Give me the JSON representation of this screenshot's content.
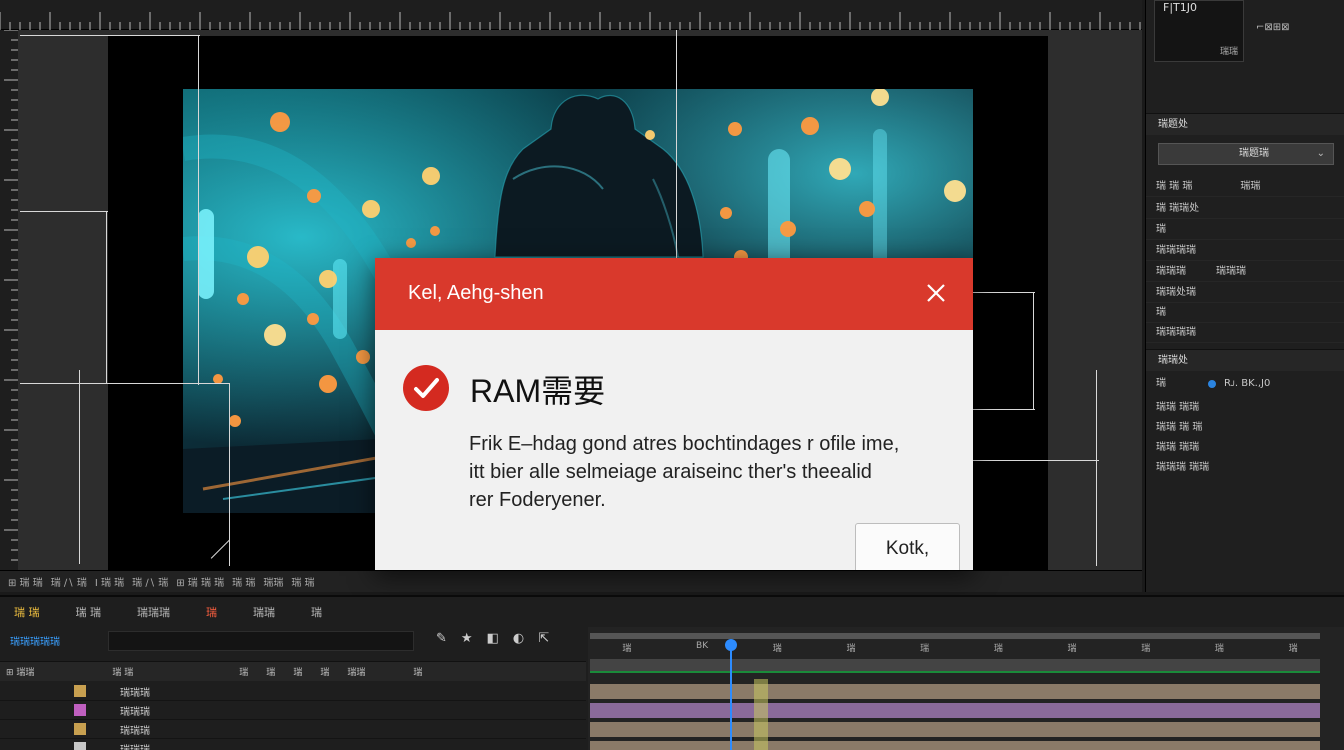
{
  "top_right": {
    "label": "F|T1J0",
    "sub": "⌐⊠⊞⊠"
  },
  "dialog": {
    "title": "Kel, Aehg-shen",
    "heading": "RAM需要",
    "body_lines": [
      "Frik E–hdag gond atres bochtindages r ofile ime,",
      "itt bier alle selmeiage araiseinc ther's theealid",
      "rer Foderyener."
    ],
    "ok_label": "Kotk,",
    "colors": {
      "titlebar": "#d9392c",
      "icon": "#d42a20",
      "background": "#f1f1f1"
    }
  },
  "right_panel": {
    "section1": "瑞题处",
    "dropdown": "瑞题瑞",
    "rows": [
      "瑞 瑞 瑞",
      "瑞 瑞瑞处",
      "瑞",
      "瑞瑞瑞瑞",
      "瑞瑞瑞",
      "瑞瑞处瑞",
      "瑞",
      "瑞瑞瑞瑞"
    ],
    "row2_right": "瑞瑞",
    "row5_right": "瑞瑞瑞",
    "section2": "瑞题处",
    "section3": "瑞瑞处",
    "props": [
      "瑞",
      "瑞瑞 瑞瑞",
      "瑞瑞 瑞 瑞",
      "瑞瑞 瑞瑞",
      "瑞瑞瑞 瑞瑞"
    ],
    "prop_value": "Rᴊ. BK.,J0"
  },
  "viewer_footer": [
    "⊞ 瑞 瑞",
    "瑞 ∕∖ 瑞",
    "Ⅰ 瑞 瑞",
    "瑞 ∕∖ 瑞",
    "⊞ 瑞 瑞 瑞",
    "瑞 瑞",
    "瑞瑞",
    "瑞 瑞"
  ],
  "timeline": {
    "tabs": [
      "瑞 瑞",
      "瑞 瑞",
      "瑞瑞瑞",
      "瑞",
      "瑞瑞",
      "瑞"
    ],
    "timecode": "瑞瑞瑞瑞瑞",
    "col_heads": [
      "⊞ 瑞瑞",
      "瑞 瑞",
      "瑞",
      "瑞",
      "瑞",
      "瑞",
      "瑞瑞",
      "瑞"
    ],
    "ruler_labels": [
      "瑞",
      "BK",
      "瑞",
      "瑞",
      "瑞",
      "瑞",
      "瑞",
      "瑞",
      "瑞",
      "瑞"
    ],
    "layers": [
      {
        "name": "瑞瑞瑞",
        "color": "#c8a050",
        "track_color": "#8a7a68"
      },
      {
        "name": "瑞瑞瑞",
        "color": "#c060c0",
        "track_color": "#8a6a9a"
      },
      {
        "name": "瑞瑞瑞",
        "color": "#c8a050",
        "track_color": "#8a7a68"
      },
      {
        "name": "瑞瑞瑞",
        "color": "#c8c8c8",
        "track_color": "#8a7a68"
      }
    ]
  }
}
